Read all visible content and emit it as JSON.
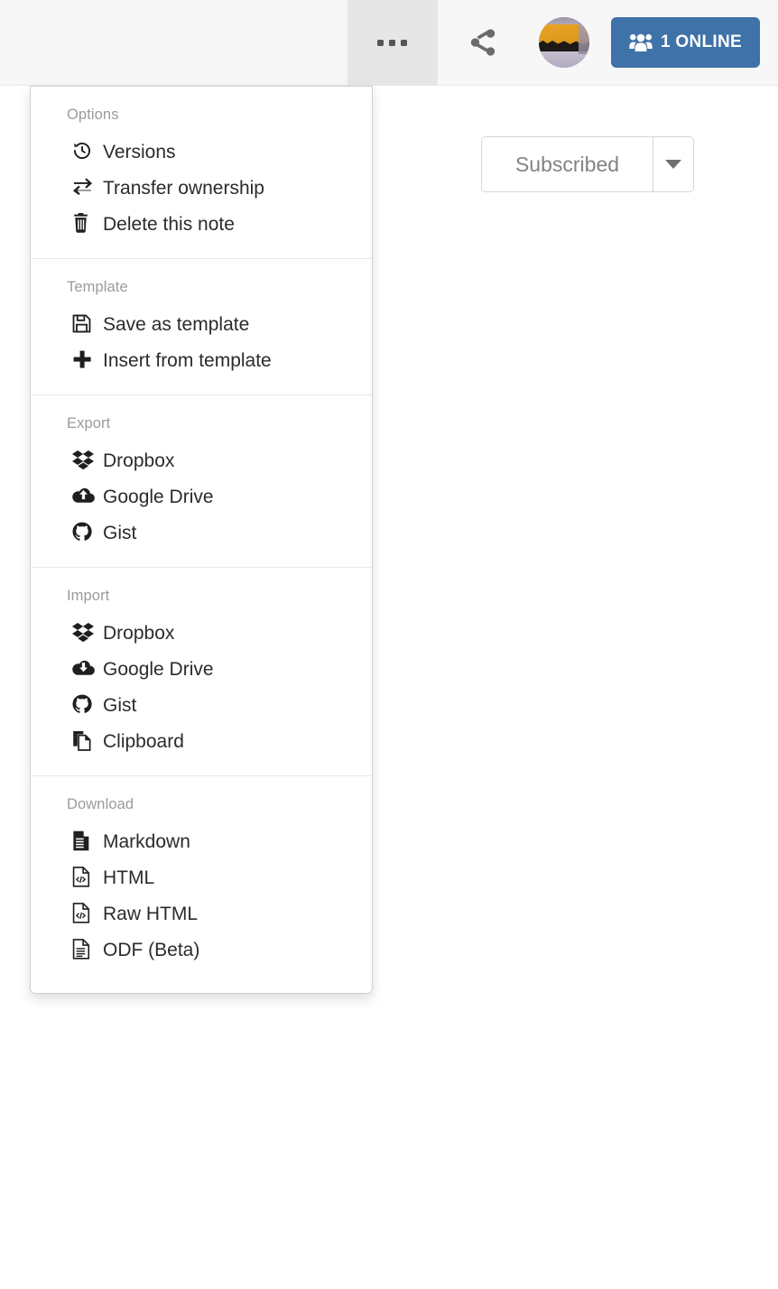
{
  "header": {
    "more_button": {
      "name": "more-options",
      "icon": "ellipsis-icon"
    },
    "share_button": {
      "name": "share",
      "icon": "share-icon"
    },
    "avatar": {
      "name": "user-avatar"
    },
    "online_button": {
      "label": "1 ONLINE",
      "icon": "users-icon",
      "color": "#3f72a8"
    }
  },
  "subscribe": {
    "label": "Subscribed",
    "caret_icon": "chevron-down-icon"
  },
  "menu": {
    "sections": [
      {
        "title": "Options",
        "items": [
          {
            "label": "Versions",
            "icon": "history-icon"
          },
          {
            "label": "Transfer ownership",
            "icon": "exchange-arrows-icon"
          },
          {
            "label": "Delete this note",
            "icon": "trash-icon"
          }
        ]
      },
      {
        "title": "Template",
        "items": [
          {
            "label": "Save as template",
            "icon": "floppy-disk-icon"
          },
          {
            "label": "Insert from template",
            "icon": "plus-icon"
          }
        ]
      },
      {
        "title": "Export",
        "items": [
          {
            "label": "Dropbox",
            "icon": "dropbox-icon"
          },
          {
            "label": "Google Drive",
            "icon": "cloud-upload-icon"
          },
          {
            "label": "Gist",
            "icon": "github-icon"
          }
        ]
      },
      {
        "title": "Import",
        "items": [
          {
            "label": "Dropbox",
            "icon": "dropbox-icon"
          },
          {
            "label": "Google Drive",
            "icon": "cloud-download-icon"
          },
          {
            "label": "Gist",
            "icon": "github-icon"
          },
          {
            "label": "Clipboard",
            "icon": "clipboard-copy-icon"
          }
        ]
      },
      {
        "title": "Download",
        "items": [
          {
            "label": "Markdown",
            "icon": "file-lines-solid-icon"
          },
          {
            "label": "HTML",
            "icon": "file-code-icon"
          },
          {
            "label": "Raw HTML",
            "icon": "file-code-icon"
          },
          {
            "label": "ODF (Beta)",
            "icon": "file-lines-icon"
          }
        ]
      }
    ]
  }
}
